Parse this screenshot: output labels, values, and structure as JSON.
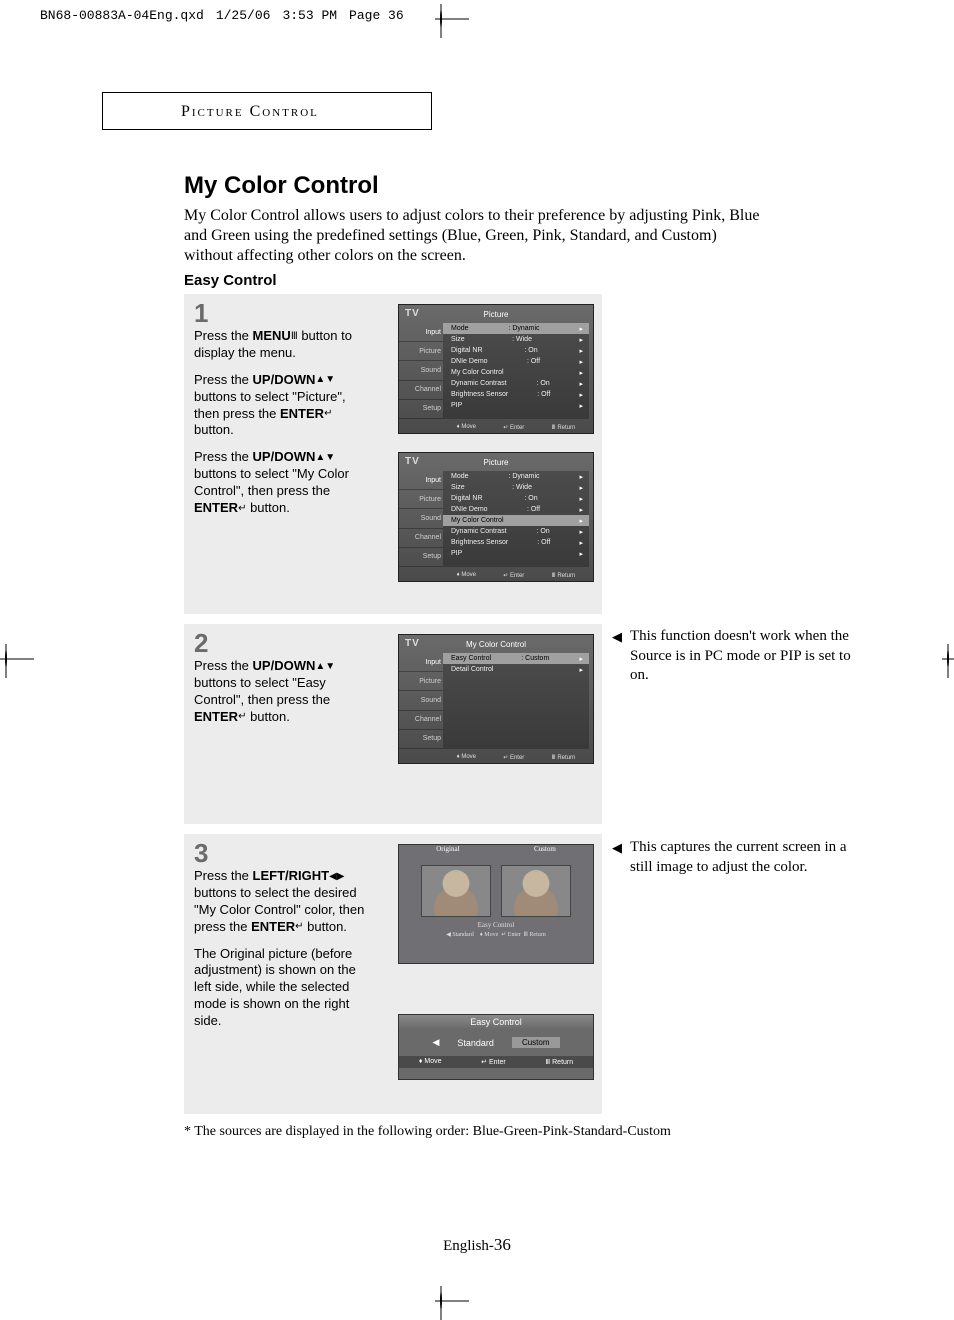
{
  "print_header": {
    "file": "BN68-00883A-04Eng.qxd",
    "date": "1/25/06",
    "time": "3:53 PM",
    "page_label": "Page 36"
  },
  "section_box": "Picture Control",
  "page_title": "My Color Control",
  "intro": "My Color Control allows users to adjust colors to their preference by adjusting Pink, Blue and Green using the predefined settings (Blue, Green, Pink, Standard, and Custom) without affecting other colors on the screen.",
  "sub_heading": "Easy Control",
  "steps": {
    "s1": {
      "num": "1",
      "p1a": "Press the ",
      "p1b": "MENU",
      "p1c": " button to display the menu.",
      "p2a": "Press the ",
      "p2b": "UP/DOWN",
      "p2c": " buttons to select \"Picture\", then press the ",
      "p2d": "ENTER",
      "p2e": " button.",
      "p3a": "Press the ",
      "p3b": "UP/DOWN",
      "p3c": " buttons to select \"My Color Control\", then press the ",
      "p3d": "ENTER",
      "p3e": " button."
    },
    "s2": {
      "num": "2",
      "p1a": "Press the ",
      "p1b": "UP/DOWN",
      "p1c": " buttons to select \"Easy Control\", then press the ",
      "p1d": "ENTER",
      "p1e": " button."
    },
    "s3": {
      "num": "3",
      "p1a": "Press the ",
      "p1b": "LEFT/RIGHT",
      "p1c": " buttons to select the desired \"My Color Control\" color, then press the ",
      "p1d": "ENTER",
      "p1e": " button.",
      "p2": "The Original picture (before adjustment) is shown on the left side, while the selected mode is shown on the right side."
    }
  },
  "menus": {
    "tv": "TV",
    "picture_title": "Picture",
    "mcc_title": "My Color Control",
    "easy_title": "Easy Control",
    "sidebar": [
      "Input",
      "Picture",
      "Sound",
      "Channel",
      "Setup"
    ],
    "rows_picture": [
      {
        "k": "Mode",
        "v": ": Dynamic"
      },
      {
        "k": "Size",
        "v": ": Wide"
      },
      {
        "k": "Digital NR",
        "v": ": On"
      },
      {
        "k": "DNIe Demo",
        "v": ": Off"
      },
      {
        "k": "My Color Control",
        "v": ""
      },
      {
        "k": "Dynamic Contrast",
        "v": ": On"
      },
      {
        "k": "Brightness Sensor",
        "v": ": Off"
      },
      {
        "k": "PIP",
        "v": ""
      }
    ],
    "rows_mcc": [
      {
        "k": "Easy Control",
        "v": ": Custom"
      },
      {
        "k": "Detail Control",
        "v": ""
      }
    ],
    "footer": {
      "move": "Move",
      "enter": "Enter",
      "return": "Return"
    },
    "easy_opts": {
      "left": "Standard",
      "right": "Custom"
    },
    "compare": {
      "left": "Original",
      "right": "Custom"
    }
  },
  "side_notes": {
    "n1": "This function doesn't work when the Source is in PC mode or PIP is set to on.",
    "n3": "This captures the current screen in a still image to adjust the color."
  },
  "footnote": "* The sources are displayed in the following order: Blue-Green-Pink-Standard-Custom",
  "pagenum_prefix": "English-",
  "pagenum": "36"
}
